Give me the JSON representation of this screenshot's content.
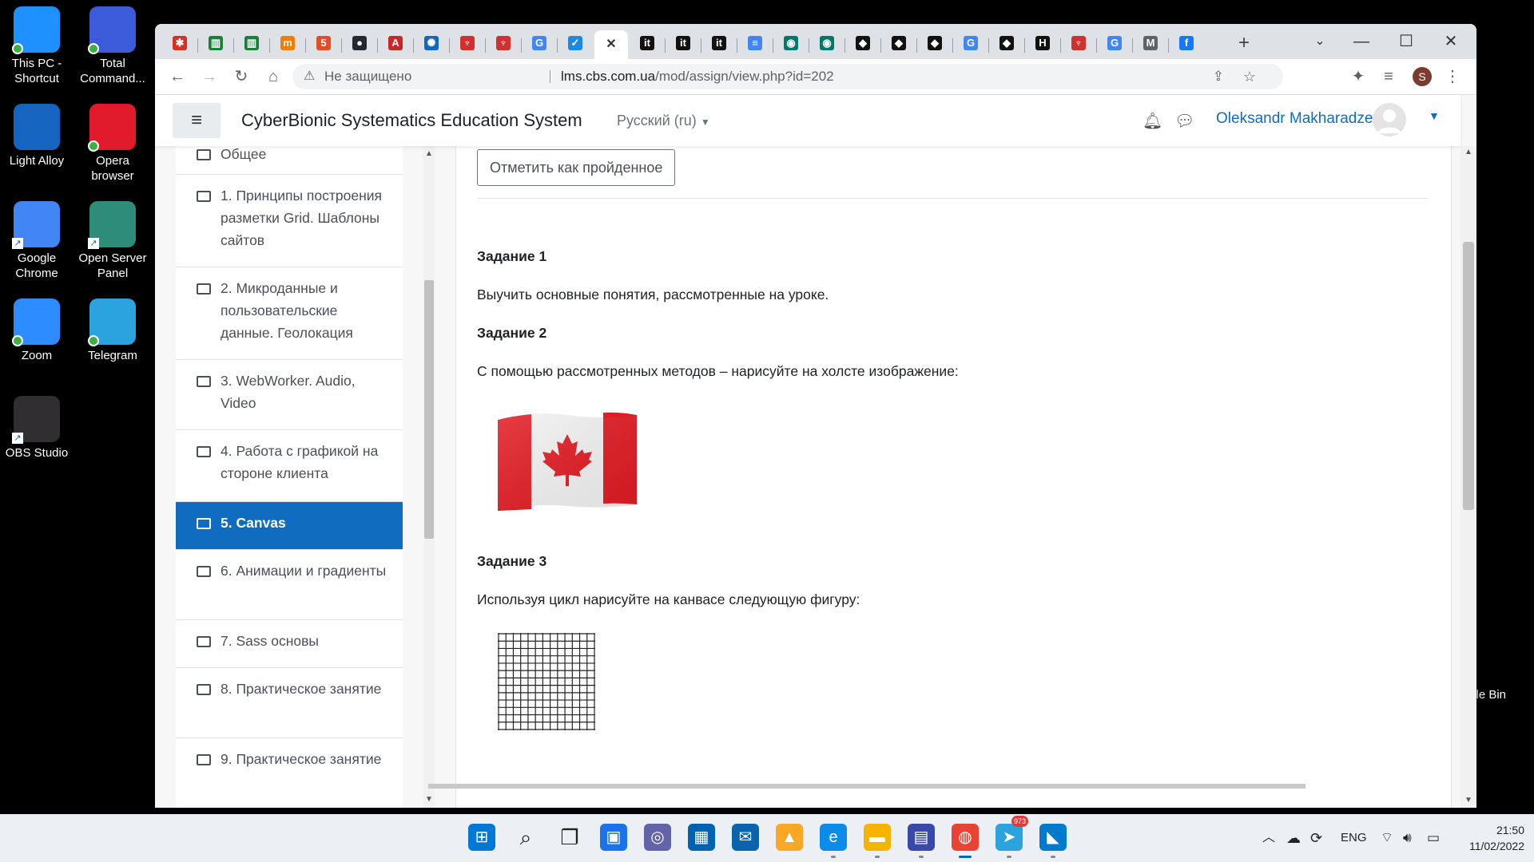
{
  "desktop": {
    "icons": [
      {
        "label": "This PC -\nShortcut",
        "color": "#1e90ff"
      },
      {
        "label": "Total\nCommand...",
        "color": "#3b5bdb"
      },
      {
        "label": "Light Alloy",
        "color": "#1565c0"
      },
      {
        "label": "Opera\nbrowser",
        "color": "#e0192b"
      },
      {
        "label": "Google\nChrome",
        "color": "#4285f4"
      },
      {
        "label": "Open Server\nPanel",
        "color": "#2d8c7a"
      },
      {
        "label": "Zoom",
        "color": "#2d8cff"
      },
      {
        "label": "Telegram",
        "color": "#2aa3df"
      },
      {
        "label": "OBS Studio",
        "color": "#302e31"
      }
    ],
    "recycle_label": "cle Bin"
  },
  "browser": {
    "tabs": [
      {
        "icon": "puzzle-colored-icon",
        "glyph": "✱",
        "color": "#d93025"
      },
      {
        "icon": "chart-icon",
        "glyph": "▥",
        "color": "#1a7f37"
      },
      {
        "icon": "chart-icon",
        "glyph": "▥",
        "color": "#1a7f37"
      },
      {
        "icon": "m-logo-icon",
        "glyph": "m",
        "color": "#f57c00"
      },
      {
        "icon": "html5-icon",
        "glyph": "5",
        "color": "#e34c26"
      },
      {
        "icon": "github-icon",
        "glyph": "●",
        "color": "#24292f"
      },
      {
        "icon": "font-a-icon",
        "glyph": "A",
        "color": "#c62828"
      },
      {
        "icon": "gear-blue-icon",
        "glyph": "✺",
        "color": "#1565c0"
      },
      {
        "icon": "person-red-icon",
        "glyph": "♆",
        "color": "#d32f2f"
      },
      {
        "icon": "person-red-icon",
        "glyph": "♆",
        "color": "#d32f2f"
      },
      {
        "icon": "google-icon",
        "glyph": "G",
        "color": "#4285f4"
      },
      {
        "icon": "check-blue-icon",
        "glyph": "✓",
        "color": "#1e88e5"
      },
      {
        "icon": "close-tab-icon",
        "glyph": "✕",
        "color": "#333333",
        "active": true
      },
      {
        "icon": "itc-icon",
        "glyph": "it",
        "color": "#111111"
      },
      {
        "icon": "itc-icon",
        "glyph": "it",
        "color": "#111111"
      },
      {
        "icon": "itc-icon",
        "glyph": "it",
        "color": "#111111"
      },
      {
        "icon": "docs-icon",
        "glyph": "≡",
        "color": "#4285f4"
      },
      {
        "icon": "circle-green-icon",
        "glyph": "◉",
        "color": "#00796b"
      },
      {
        "icon": "circle-green-icon",
        "glyph": "◉",
        "color": "#00796b"
      },
      {
        "icon": "cap-icon",
        "glyph": "◆",
        "color": "#111111"
      },
      {
        "icon": "cap-icon",
        "glyph": "◆",
        "color": "#111111"
      },
      {
        "icon": "cap-icon",
        "glyph": "◆",
        "color": "#111111"
      },
      {
        "icon": "google-icon",
        "glyph": "G",
        "color": "#4285f4"
      },
      {
        "icon": "cap-icon",
        "glyph": "◆",
        "color": "#111111"
      },
      {
        "icon": "h-icon",
        "glyph": "H",
        "color": "#111111"
      },
      {
        "icon": "person-red-icon",
        "glyph": "♆",
        "color": "#d32f2f"
      },
      {
        "icon": "google-icon",
        "glyph": "G",
        "color": "#4285f4"
      },
      {
        "icon": "gmail-icon",
        "glyph": "M",
        "color": "#5f6368"
      },
      {
        "icon": "facebook-icon",
        "glyph": "f",
        "color": "#1877f2"
      }
    ],
    "security_label": "Не защищено",
    "url_host": "lms.cbs.com.ua",
    "url_path": "/mod/assign/view.php?id=202",
    "profile_initial": "S"
  },
  "navbar": {
    "site_name": "CyberBionic Systematics Education System",
    "language": "Русский (ru)",
    "user_name": "Oleksandr Makharadze"
  },
  "sidebar": {
    "items": [
      {
        "label": "Общее",
        "active": false
      },
      {
        "label": "1. Принципы построения разметки Grid. Шаблоны сайтов",
        "active": false
      },
      {
        "label": "2. Микроданные и пользовательские данные. Геолокация",
        "active": false
      },
      {
        "label": "3. WebWorker. Audio, Video",
        "active": false
      },
      {
        "label": "4. Работа с графикой на стороне клиента",
        "active": false
      },
      {
        "label": "5. Canvas",
        "active": true
      },
      {
        "label": "6. Анимации и градиенты",
        "active": false
      },
      {
        "label": "7. Sass основы",
        "active": false
      },
      {
        "label": "8. Практическое занятие",
        "active": false
      },
      {
        "label": "9. Практическое занятие",
        "active": false
      }
    ]
  },
  "main": {
    "mark_done_label": "Отметить как пройденное",
    "task1_title": "Задание 1",
    "task1_text": "Выучить основные понятия, рассмотренные на уроке.",
    "task2_title": "Задание 2",
    "task2_text": "С помощью рассмотренных методов – нарисуйте на холсте изображение:",
    "task3_title": "Задание 3",
    "task3_text": "Используя цикл нарисуйте на канвасе следующую фигуру:",
    "grid_lines": 14
  },
  "taskbar": {
    "apps": [
      {
        "icon": "windows-start-icon",
        "glyph": "⊞",
        "color": "#0078d4"
      },
      {
        "icon": "search-icon",
        "glyph": "⌕",
        "color": "#222222"
      },
      {
        "icon": "task-view-icon",
        "glyph": "❐",
        "color": "#222222"
      },
      {
        "icon": "widgets-icon",
        "glyph": "▣",
        "color": "#1a73e8"
      },
      {
        "icon": "teams-chat-icon",
        "glyph": "◎",
        "color": "#6264a7"
      },
      {
        "icon": "store-icon",
        "glyph": "▦",
        "color": "#0063b1"
      },
      {
        "icon": "mail-icon",
        "glyph": "✉",
        "color": "#0a64ad"
      },
      {
        "icon": "light-alloy-icon",
        "glyph": "▲",
        "color": "#f9a825"
      },
      {
        "icon": "edge-icon",
        "glyph": "e",
        "color": "#0c8ce9"
      },
      {
        "icon": "file-explorer-icon",
        "glyph": "▬",
        "color": "#f4b400"
      },
      {
        "icon": "total-commander-icon",
        "glyph": "▤",
        "color": "#3949ab"
      },
      {
        "icon": "chrome-icon",
        "glyph": "◍",
        "color": "#ea4335"
      },
      {
        "icon": "telegram-icon",
        "glyph": "➤",
        "color": "#2aa3df"
      },
      {
        "icon": "vscode-icon",
        "glyph": "◣",
        "color": "#007acc"
      }
    ],
    "telegram_badge": "973",
    "language": "ENG",
    "time": "21:50",
    "date": "11/02/2022"
  }
}
